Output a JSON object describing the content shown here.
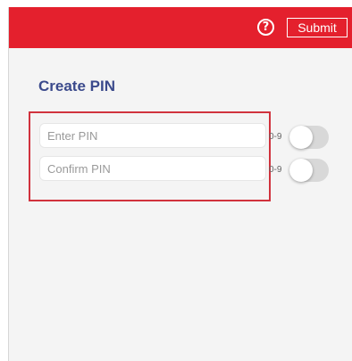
{
  "header": {
    "help_icon": "question-circle-icon",
    "help_glyph": "?",
    "submit_label": "Submit",
    "bar_color": "#e4202d"
  },
  "page": {
    "title": "Create PIN",
    "title_color": "#3b4a8c"
  },
  "fields": [
    {
      "placeholder": "Enter PIN",
      "range_label": "0-9",
      "toggle_on": false
    },
    {
      "placeholder": "Confirm PIN",
      "range_label": "0-9",
      "toggle_on": false
    }
  ]
}
